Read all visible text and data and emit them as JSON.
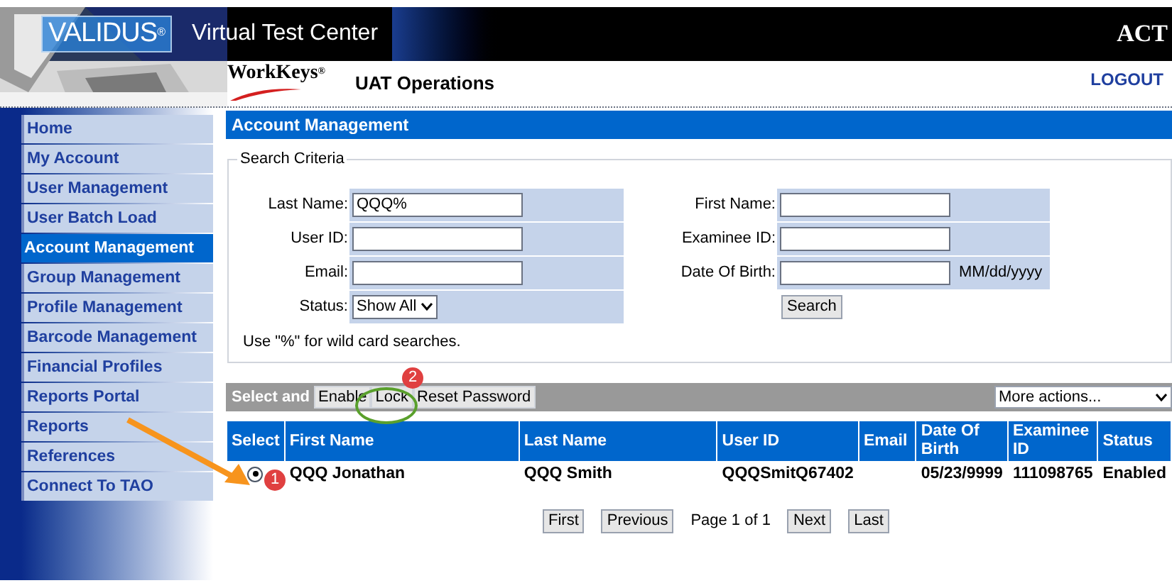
{
  "header": {
    "brand": "VALIDUS",
    "brand_mark": "®",
    "app_title": "Virtual Test Center",
    "partner_logo": "ACT",
    "product_logo": "WorkKeys",
    "product_mark": "®",
    "environment": "UAT Operations",
    "logout": "LOGOUT"
  },
  "sidebar": {
    "items": [
      {
        "label": "Home",
        "selected": false
      },
      {
        "label": "My Account",
        "selected": false
      },
      {
        "label": "User Management",
        "selected": false
      },
      {
        "label": "User Batch Load",
        "selected": false
      },
      {
        "label": "Account Management",
        "selected": true
      },
      {
        "label": "Group Management",
        "selected": false
      },
      {
        "label": "Profile Management",
        "selected": false
      },
      {
        "label": "Barcode Management",
        "selected": false
      },
      {
        "label": "Financial Profiles",
        "selected": false
      },
      {
        "label": "Reports Portal",
        "selected": false
      },
      {
        "label": "Reports",
        "selected": false
      },
      {
        "label": "References",
        "selected": false
      },
      {
        "label": "Connect To TAO",
        "selected": false
      }
    ]
  },
  "panel": {
    "title": "Account Management"
  },
  "search": {
    "legend": "Search Criteria",
    "left_fields": [
      {
        "label": "Last Name:",
        "kind": "text",
        "value": "QQQ%"
      },
      {
        "label": "User ID:",
        "kind": "text"
      },
      {
        "label": "Email:",
        "kind": "text"
      },
      {
        "label": "Status:",
        "kind": "select",
        "value": "Show All"
      }
    ],
    "right_fields": [
      {
        "label": "First Name:",
        "kind": "text"
      },
      {
        "label": "Examinee ID:",
        "kind": "text"
      },
      {
        "label": "Date Of Birth:",
        "kind": "text",
        "suffix": "MM/dd/yyyy"
      }
    ],
    "button": "Search",
    "hint": "Use \"%\" for wild card searches."
  },
  "toolbar": {
    "label": "Select and",
    "buttons": [
      "Enable",
      "Lock",
      "Reset Password"
    ],
    "more_actions": "More actions..."
  },
  "table": {
    "columns": [
      {
        "label": "Select"
      },
      {
        "label": "First Name"
      },
      {
        "label": "Last Name"
      },
      {
        "label": "User ID"
      },
      {
        "label": "Email"
      },
      {
        "label": "Date Of Birth"
      },
      {
        "label": "Examinee ID"
      },
      {
        "label": "Status"
      }
    ],
    "rows": [
      {
        "selected": true,
        "first_name": "QQQ Jonathan",
        "last_name": "QQQ Smith",
        "user_id": "QQQSmitQ67402",
        "date_of_birth": "05/23/9999",
        "examinee_id": "111098765",
        "status": "Enabled"
      }
    ]
  },
  "pagination": {
    "items": [
      {
        "kind": "button",
        "label": "First"
      },
      {
        "kind": "button",
        "label": "Previous"
      },
      {
        "kind": "text",
        "label": "Page 1 of 1"
      },
      {
        "kind": "button",
        "label": "Next"
      },
      {
        "kind": "button",
        "label": "Last"
      }
    ]
  },
  "annotations": [
    {
      "kind": "arrow"
    },
    {
      "kind": "badge",
      "label": "1"
    },
    {
      "kind": "ring"
    },
    {
      "kind": "badge",
      "label": "2"
    }
  ]
}
